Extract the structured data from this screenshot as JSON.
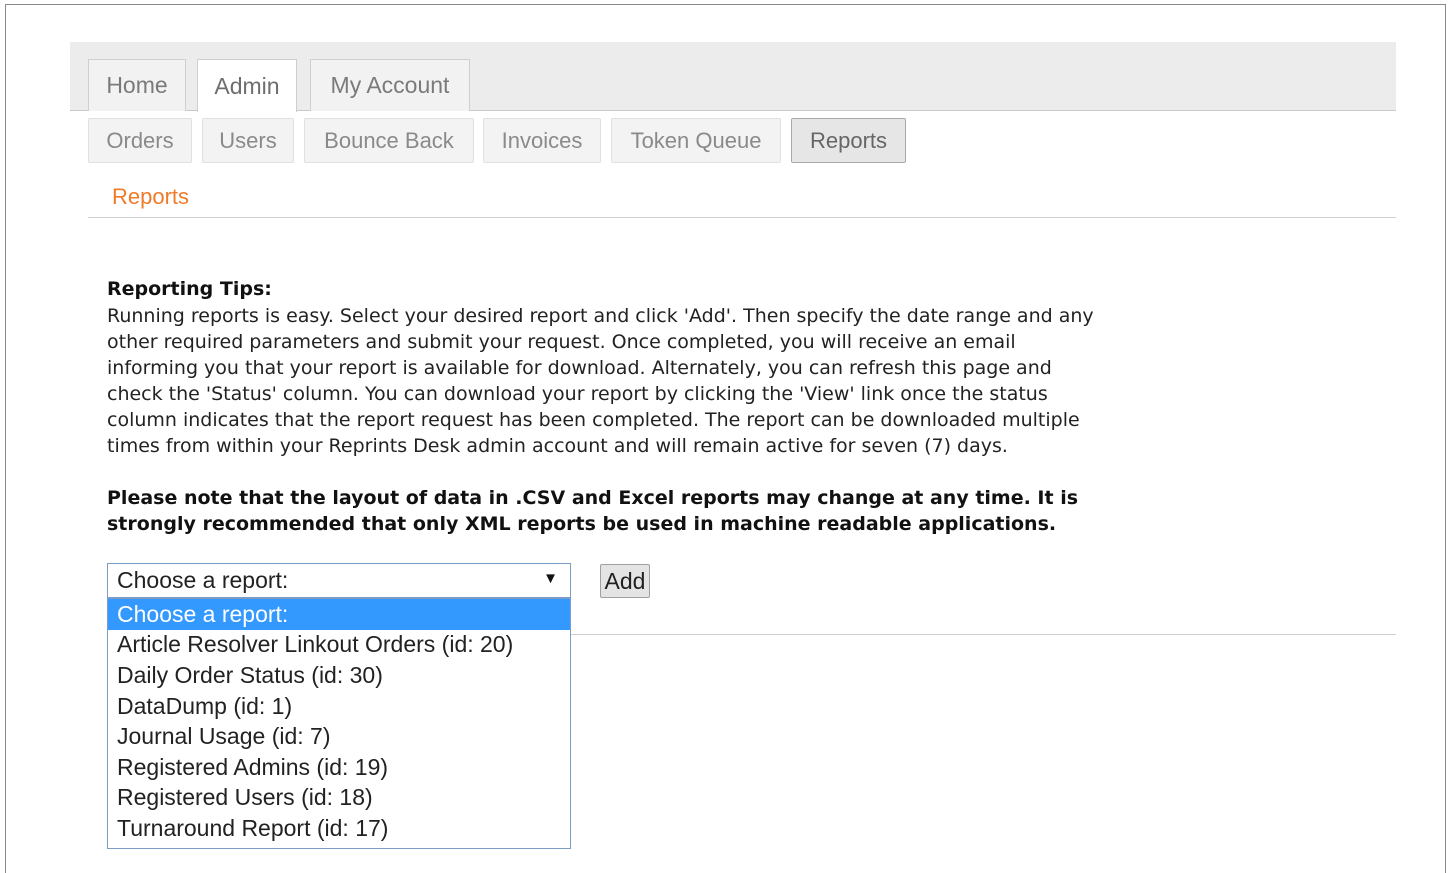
{
  "main_tabs": [
    {
      "label": "Home",
      "active": false
    },
    {
      "label": "Admin",
      "active": true
    },
    {
      "label": "My Account",
      "active": false
    }
  ],
  "sub_tabs": [
    {
      "label": "Orders",
      "active": false
    },
    {
      "label": "Users",
      "active": false
    },
    {
      "label": "Bounce Back",
      "active": false
    },
    {
      "label": "Invoices",
      "active": false
    },
    {
      "label": "Token Queue",
      "active": false
    },
    {
      "label": "Reports",
      "active": true
    }
  ],
  "breadcrumb": "Reports",
  "tips": {
    "title": "Reporting Tips:",
    "lines": [
      "Running reports is easy. Select your desired report and click 'Add'. Then specify the date range and any",
      "other required parameters and submit your request. Once completed, you will receive an email",
      "informing you that your report is available for download. Alternately, you can refresh this page and",
      "check the 'Status' column. You can download your report by clicking the 'View' link once the status",
      "column indicates that the report request has been completed. The report can be downloaded multiple",
      "times from within your Reprints Desk admin account and will remain active for seven (7) days."
    ]
  },
  "note": {
    "lines": [
      "Please note that the layout of data in .CSV and Excel reports may change at any time. It is",
      "strongly recommended that only XML reports be used in machine readable applications."
    ]
  },
  "report_select": {
    "value": "Choose a report:",
    "options": [
      {
        "label": "Choose a report:",
        "highlighted": true
      },
      {
        "label": "Article Resolver Linkout Orders (id: 20)",
        "highlighted": false
      },
      {
        "label": "Daily Order Status (id: 30)",
        "highlighted": false
      },
      {
        "label": "DataDump (id: 1)",
        "highlighted": false
      },
      {
        "label": "Journal Usage (id: 7)",
        "highlighted": false
      },
      {
        "label": "Registered Admins (id: 19)",
        "highlighted": false
      },
      {
        "label": "Registered Users (id: 18)",
        "highlighted": false
      },
      {
        "label": "Turnaround Report (id: 17)",
        "highlighted": false
      }
    ]
  },
  "add_button": "Add",
  "colors": {
    "accent_orange": "#f07a28",
    "highlight_blue": "#3399ff",
    "select_border": "#7a9cc6"
  }
}
